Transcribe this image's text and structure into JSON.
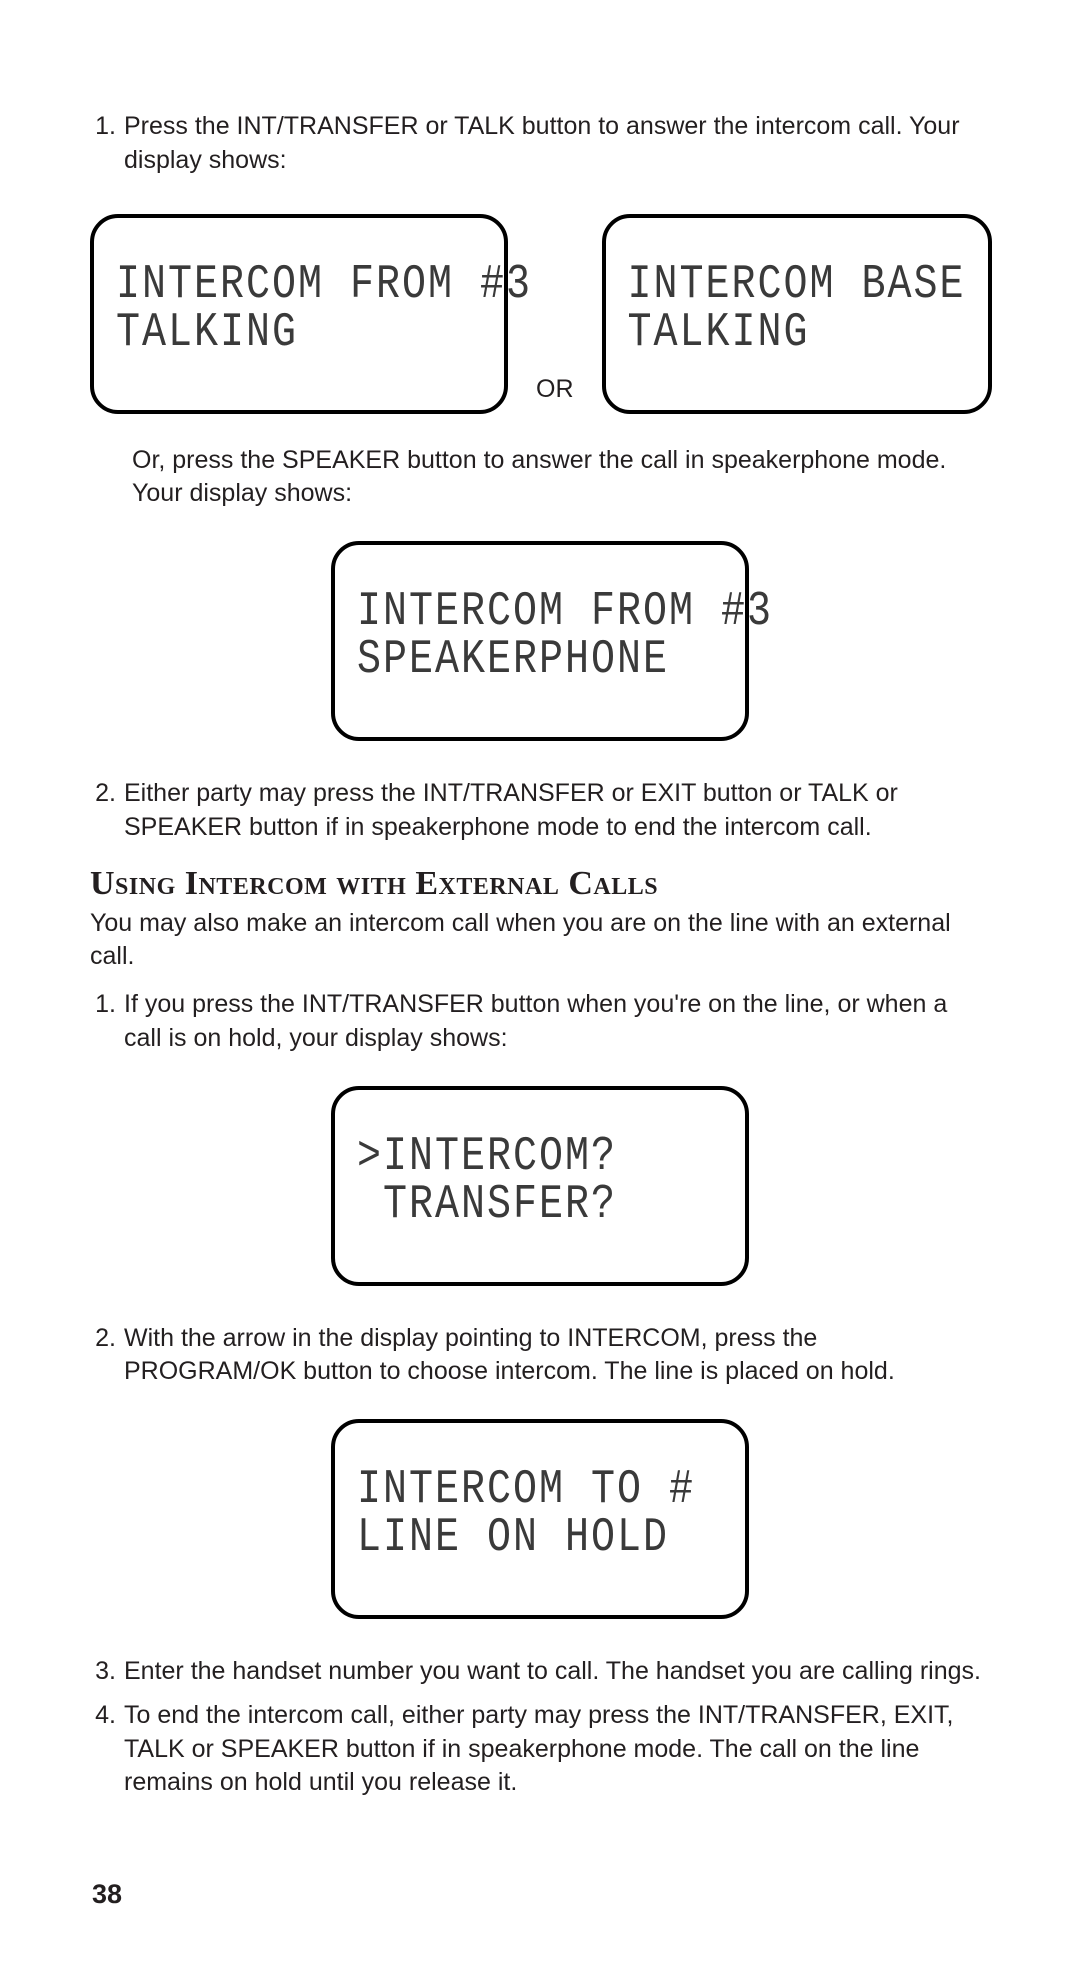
{
  "step1": {
    "num": "1.",
    "text": "Press the INT/TRANSFER or TALK button to answer the intercom call. Your display shows:"
  },
  "display1_left": {
    "line1": "INTERCOM FROM #3",
    "line2": "TALKING"
  },
  "or_label": "OR",
  "display1_right": {
    "line1": "INTERCOM BASE",
    "line2": "TALKING"
  },
  "step1b": "Or, press the SPEAKER button to answer the call in speakerphone mode. Your display shows:",
  "display2": {
    "line1": "INTERCOM FROM #3",
    "line2": "SPEAKERPHONE"
  },
  "step2": {
    "num": "2.",
    "text": "Either party may press the INT/TRANSFER or EXIT button or TALK or SPEAKER button if in speakerphone mode to end the intercom call."
  },
  "heading": "Using Intercom with External Calls",
  "intro": "You may also make an intercom call when you are on the line with an external call.",
  "ext1": {
    "num": "1.",
    "text": "If you press the INT/TRANSFER button when you're on the line, or when a call is on hold, your display shows:"
  },
  "display3": {
    "line1": ">INTERCOM?",
    "line2": " TRANSFER?"
  },
  "ext2": {
    "num": "2.",
    "text": "With the arrow in the display pointing to INTERCOM, press the PROGRAM/OK button to choose intercom. The line is placed on hold."
  },
  "display4": {
    "line1": "INTERCOM TO #",
    "line2": "LINE ON HOLD"
  },
  "ext3": {
    "num": "3.",
    "text": "Enter the handset number you want to call. The handset you are calling rings."
  },
  "ext4": {
    "num": "4.",
    "text": "To end the intercom call, either party may press the INT/TRANSFER, EXIT, TALK or SPEAKER button if in speakerphone mode. The call on the line remains on hold until you release it."
  },
  "page_number": "38"
}
